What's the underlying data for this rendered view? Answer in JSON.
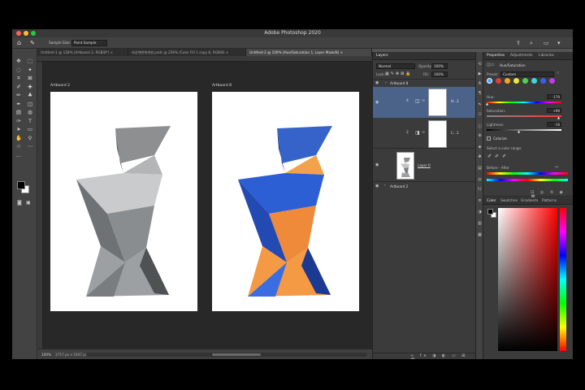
{
  "window": {
    "title": "Adobe Photoshop 2020"
  },
  "options_bar": {
    "sample_size_label": "Sample Size:",
    "sample_size_value": "Point Sample"
  },
  "tabs": [
    {
      "label": "Untitled-1 @ 128% (Artboard 2, RGB/8*) ×"
    },
    {
      "label": "회상해변해개발.psdc @ 256% (Color Fill 1 copy 8, RGB/8) ×"
    },
    {
      "label": "Untitled-2 @ 100% (Hue/Saturation 1, Layer Mask/8) ×"
    }
  ],
  "canvas": {
    "artboard_left_label": "Artboard 2",
    "artboard_right_label": "Artboard 8"
  },
  "status": {
    "zoom": "100%",
    "doc_info": "3757 px x 1947 px (72 ppi)"
  },
  "layers_panel": {
    "tab": "Layers",
    "blend_mode": "Normal",
    "opacity_label": "Opacity:",
    "opacity_value": "100%",
    "lock_label": "Lock:",
    "fill_label": "Fill:",
    "fill_value": "100%",
    "group1_name": "Artboard 8",
    "layer_hue_name": "H...1",
    "layer_color_name": "C...1",
    "layer_image_name": "Layer 0",
    "group2_name": "Artboard 2"
  },
  "properties_panel": {
    "tabs": [
      "Properties",
      "Adjustments",
      "Libraries"
    ],
    "adjustment_title": "Hue/Saturation",
    "preset_label": "Preset:",
    "preset_value": "Custom",
    "hue_label": "Hue:",
    "hue_value": "-170",
    "saturation_label": "Saturation:",
    "saturation_value": "+90",
    "lightness_label": "Lightness:",
    "lightness_value": "-16",
    "colorize_label": "Colorize",
    "color_range_label": "Select a color range:",
    "before_after_label": "Before - After"
  },
  "color_panel": {
    "tabs": [
      "Color",
      "Swatches",
      "Gradients",
      "Patterns"
    ]
  },
  "colors": {
    "preset_swatches": [
      "#e23b3b",
      "#f5a623",
      "#e8e83a",
      "#4dd04d",
      "#3fd6d6",
      "#3a5fe8",
      "#c23be8"
    ],
    "selected_layer_bg": "#4b6389"
  }
}
